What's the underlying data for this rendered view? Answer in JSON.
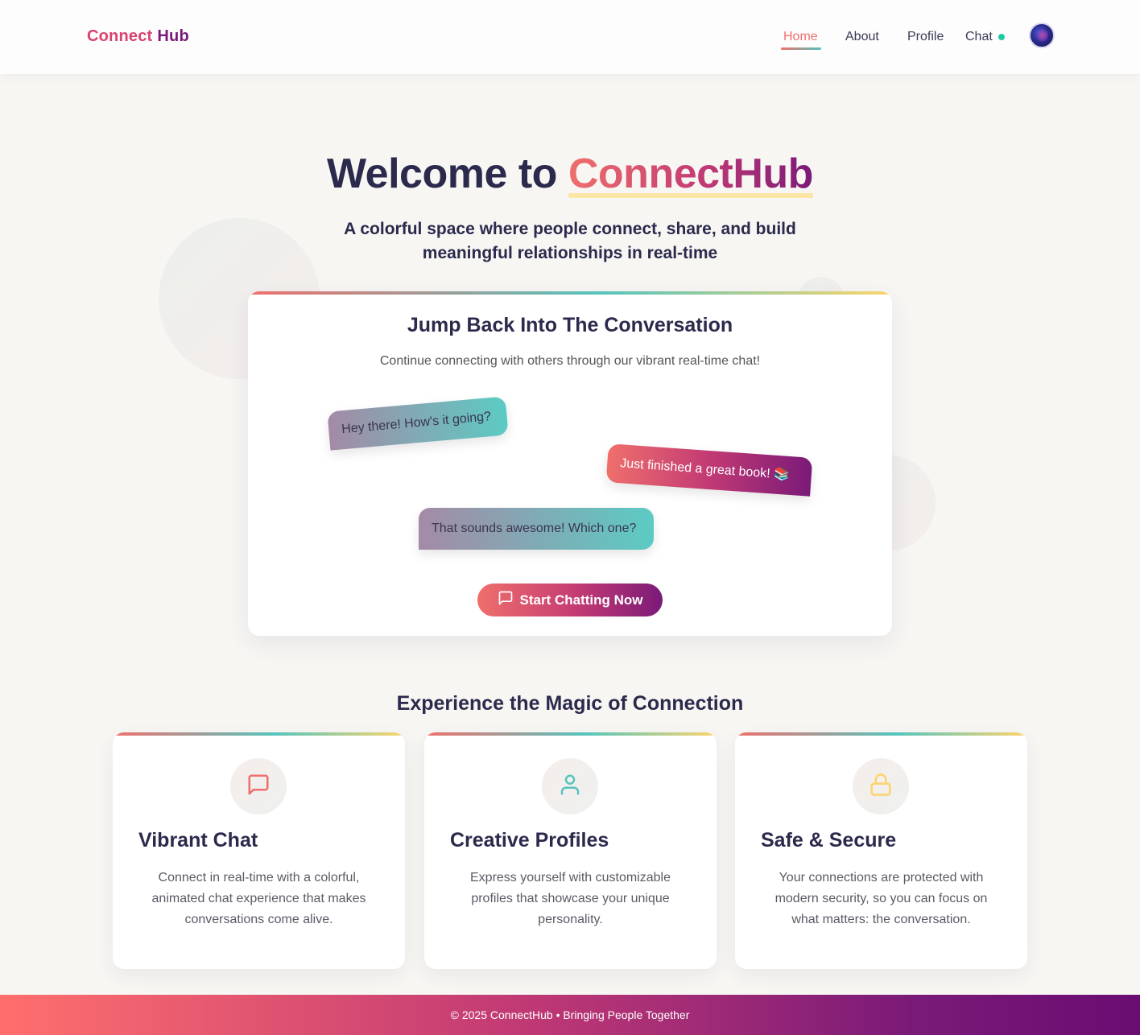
{
  "header": {
    "logo_part1": "Connect",
    "logo_part2": "Hub",
    "nav": {
      "home": "Home",
      "about": "About",
      "profile": "Profile",
      "chat": "Chat"
    }
  },
  "hero": {
    "title_prefix": "Welcome to",
    "title_brand": "ConnectHub",
    "subtitle": "A colorful space where people connect, share, and build meaningful relationships in real-time"
  },
  "conversation": {
    "title": "Jump Back Into The Conversation",
    "subtitle": "Continue connecting with others through our vibrant real-time chat!",
    "messages": [
      {
        "text": "Hey there! How's it going?",
        "side": "incoming"
      },
      {
        "text": "Just finished a great book! 📚",
        "side": "outgoing"
      },
      {
        "text": "That sounds awesome! Which one?",
        "side": "incoming"
      }
    ],
    "button_label": "Start Chatting Now",
    "button_icon": "message-square-icon"
  },
  "features": {
    "title": "Experience the Magic of Connection",
    "items": [
      {
        "icon": "message-square-icon",
        "icon_color": "#ef6f6c",
        "name": "Vibrant Chat",
        "description": "Connect in real-time with a colorful, animated chat experience that makes conversations come alive."
      },
      {
        "icon": "user-icon",
        "icon_color": "#56c4bd",
        "name": "Creative Profiles",
        "description": "Express yourself with customizable profiles that showcase your unique personality."
      },
      {
        "icon": "lock-icon",
        "icon_color": "#fbd56b",
        "name": "Safe & Secure",
        "description": "Your connections are protected with modern security, so you can focus on what matters: the conversation."
      }
    ]
  },
  "footer": {
    "text": "© 2025 ConnectHub • Bringing People Together"
  },
  "colors": {
    "coral": "#ef6f6c",
    "teal": "#56c4bd",
    "yellow": "#fbd56b",
    "purple": "#7a1a78",
    "navy": "#2b2a4c",
    "online": "#1fc8a0"
  }
}
